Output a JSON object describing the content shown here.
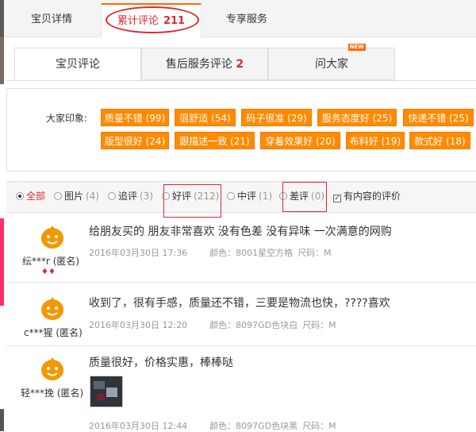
{
  "top_tabs": {
    "details": "宝贝详情",
    "reviews": "累计评论",
    "reviews_count": "211",
    "service": "专享服务"
  },
  "inner_tabs": {
    "reviews": "宝贝评论",
    "after_sale": "售后服务评论",
    "after_sale_count": "2",
    "ask": "问大家",
    "ask_badge": "NEW"
  },
  "impressions": {
    "label": "大家印象:",
    "tags": [
      "质量不错 (99)",
      "很舒适 (54)",
      "码子很准 (29)",
      "服务态度好 (25)",
      "快递不错 (25)",
      "版型很好 (24)",
      "跟描述一致 (21)",
      "穿着效果好 (20)",
      "布料好 (19)",
      "款式好 (18)"
    ]
  },
  "filters": {
    "all": "全部",
    "pic": "图片",
    "pic_count": "(4)",
    "append": "追评",
    "append_count": "(3)",
    "good": "好评",
    "good_count": "(212)",
    "mid": "中评",
    "mid_count": "(1)",
    "bad": "差评",
    "bad_count": "(0)",
    "content_only": "有内容的评价"
  },
  "reviews": [
    {
      "user": "纭***r (匿名)",
      "text": "给朋友买的 朋友非常喜欢 没有色差 没有异味 一次满意的网购",
      "date": "2016年03月30日 17:36",
      "color": "颜色：8001星空方格",
      "size": "尺码：M",
      "badge": "♦♦"
    },
    {
      "user": "c***猩 (匿名)",
      "text": "收到了，很有手感，质量还不错，三要是物流也快，????喜欢",
      "date": "2016年03月30日 12:20",
      "color": "颜色：8097GD色块白",
      "size": "尺码：M"
    },
    {
      "user": "轻***挽 (匿名)",
      "text": "质量很好，价格实惠，棒棒哒",
      "date": "2016年03月30日 12:44",
      "color": "颜色：8097GD色块黑",
      "size": "尺码：M"
    }
  ],
  "colors": {
    "accent_orange": "#ff8a00",
    "tag_border": "#f27c00",
    "red": "#e0272c"
  }
}
